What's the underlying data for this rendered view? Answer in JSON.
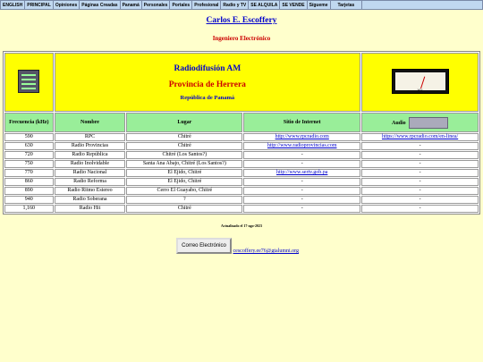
{
  "nav": [
    {
      "label": "ENGLISH"
    },
    {
      "label": "PRINCIPAL"
    },
    {
      "label": "Opiniones"
    },
    {
      "label": "Páginas Creadas"
    },
    {
      "label": "Panamá"
    },
    {
      "label": "Personales"
    },
    {
      "label": "Portales"
    },
    {
      "label": "Profesional"
    },
    {
      "label": "Radio y TV"
    },
    {
      "label": "SE ALQUILA"
    },
    {
      "label": "SE VENDE"
    },
    {
      "label": "Sígueme"
    },
    {
      "label": "Tarjetas"
    }
  ],
  "site": {
    "title": "Carlos E. Escoffery",
    "subtitle": "Ingeniero Electrónico"
  },
  "header": {
    "title": "Radiodifusión AM",
    "province": "Provincia de Herrera",
    "country": "República de Panamá",
    "vu_label": "VU"
  },
  "columns": [
    "Frecuencia (kHz)",
    "Nombre",
    "Lugar",
    "Sitio de Internet",
    "Audio"
  ],
  "rows": [
    {
      "freq": "590",
      "name": "RPC",
      "place": "Chitré",
      "site": "http://www.rpcradio.com",
      "audio": "https://www.rpcradio.com/en-linea/"
    },
    {
      "freq": "630",
      "name": "Radio Provincias",
      "place": "Chitré",
      "site": "http://www.radioprovincias.com",
      "audio": "-"
    },
    {
      "freq": "720",
      "name": "Radio República",
      "place": "Chitré (Los Santos?)",
      "site": "-",
      "audio": "-"
    },
    {
      "freq": "750",
      "name": "Radio Inolvidable",
      "place": "Santa Ana Abajo, Chitré (Los Santos?)",
      "site": "-",
      "audio": "-"
    },
    {
      "freq": "770",
      "name": "Radio Nacional",
      "place": "El Ejido, Chitré",
      "site": "http://www.sertv.gob.pa",
      "audio": "-"
    },
    {
      "freq": "860",
      "name": "Radio Reforma",
      "place": "El Ejido, Chitré",
      "site": "-",
      "audio": "-"
    },
    {
      "freq": "890",
      "name": "Radio Ritmo Estereo",
      "place": "Cerro El Guayabo, Chitré",
      "site": "-",
      "audio": "-"
    },
    {
      "freq": "940",
      "name": "Radio Soberana",
      "place": "?",
      "site": "-",
      "audio": "-"
    },
    {
      "freq": "1,160",
      "name": "Radio Hit",
      "place": "Chitré",
      "site": "-",
      "audio": "-"
    }
  ],
  "footer": {
    "updated": "Actualizado el 17-ago-2023",
    "email_button": "Correo Electrónico",
    "email": "cescoffery.ee76@gtalumni.org"
  }
}
